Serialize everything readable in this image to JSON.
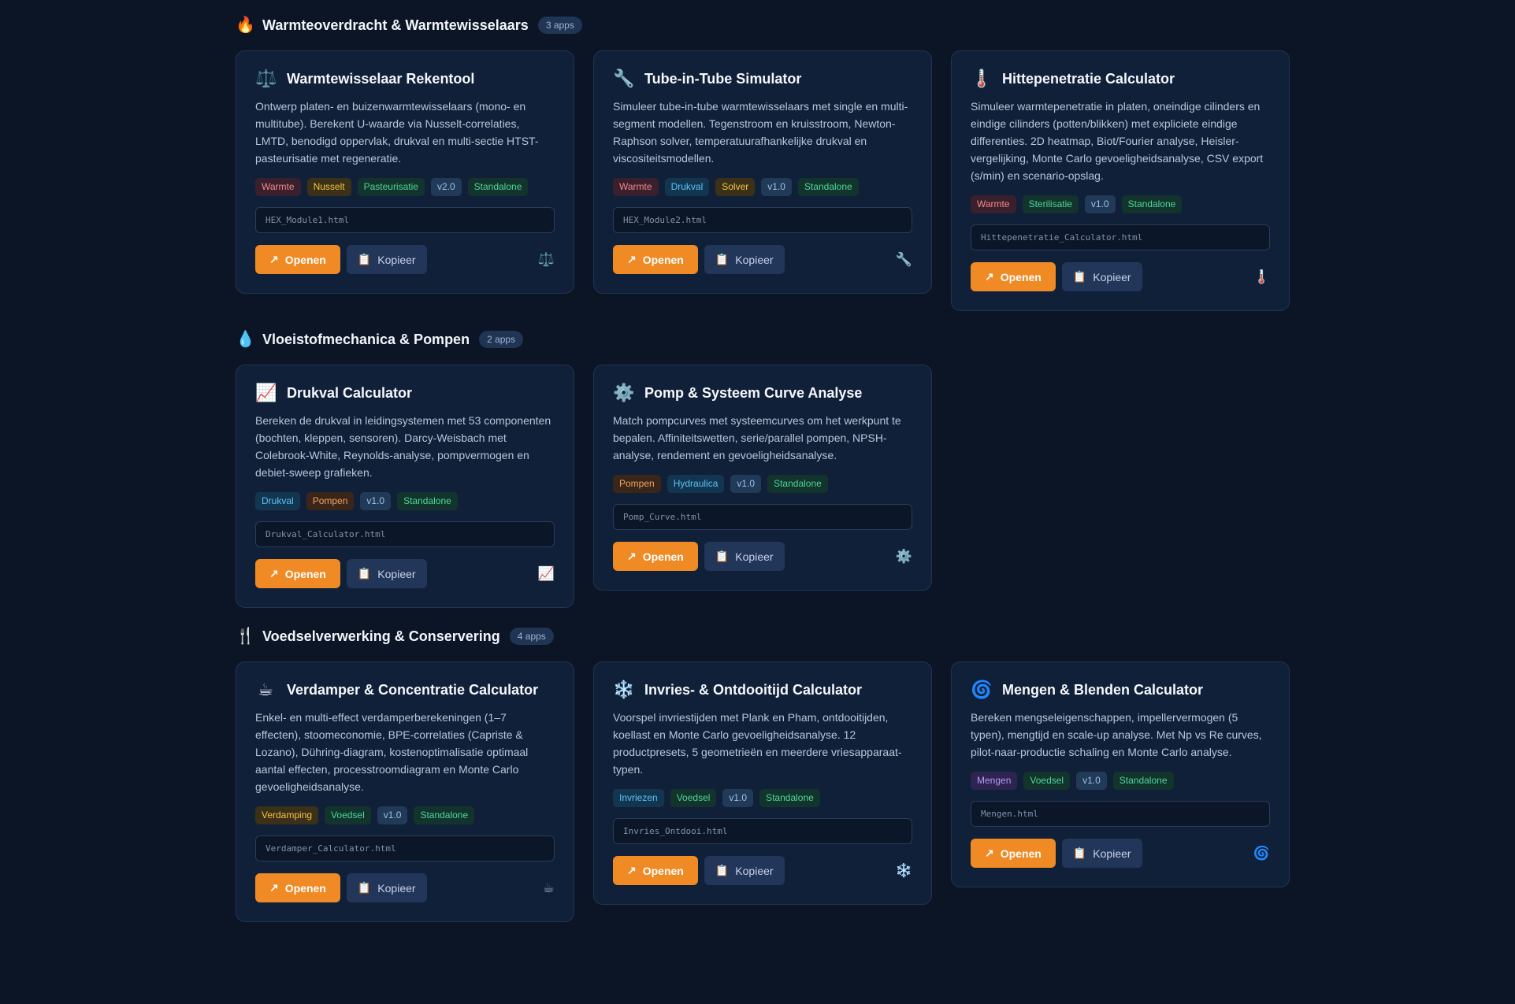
{
  "sections": [
    {
      "icon": "🔥",
      "title": "Warmteoverdracht & Warmtewisselaars",
      "count": "3 apps",
      "cards": [
        {
          "icon": "⚖️",
          "title": "Warmtewisselaar Rekentool",
          "description": "Ontwerp platen- en buizenwarmtewisselaars (mono- en multitube). Berekent U-waarde via Nusselt-correlaties, LMTD, benodigd oppervlak, drukval en multi-sectie HTST-pasteurisatie met regeneratie.",
          "tags": [
            {
              "label": "Warmte",
              "color": "red"
            },
            {
              "label": "Nusselt",
              "color": "yellow"
            },
            {
              "label": "Pasteurisatie",
              "color": "green"
            },
            {
              "label": "v2.0",
              "color": "blue"
            },
            {
              "label": "Standalone",
              "color": "green"
            }
          ],
          "file": "HEX_Module1.html"
        },
        {
          "icon": "🔧",
          "title": "Tube-in-Tube Simulator",
          "description": "Simuleer tube-in-tube warmtewisselaars met single en multi-segment modellen. Tegenstroom en kruisstroom, Newton-Raphson solver, temperatuurafhankelijke drukval en viscositeitsmodellen.",
          "tags": [
            {
              "label": "Warmte",
              "color": "red"
            },
            {
              "label": "Drukval",
              "color": "cyan"
            },
            {
              "label": "Solver",
              "color": "yellow"
            },
            {
              "label": "v1.0",
              "color": "blue"
            },
            {
              "label": "Standalone",
              "color": "green"
            }
          ],
          "file": "HEX_Module2.html"
        },
        {
          "icon": "🌡️",
          "title": "Hittepenetratie Calculator",
          "description": "Simuleer warmtepenetratie in platen, oneindige cilinders en eindige cilinders (potten/blikken) met expliciete eindige differenties. 2D heatmap, Biot/Fourier analyse, Heisler-vergelijking, Monte Carlo gevoeligheidsanalyse, CSV export (s/min) en scenario-opslag.",
          "tags": [
            {
              "label": "Warmte",
              "color": "red"
            },
            {
              "label": "Sterilisatie",
              "color": "green"
            },
            {
              "label": "v1.0",
              "color": "blue"
            },
            {
              "label": "Standalone",
              "color": "green"
            }
          ],
          "file": "Hittepenetratie_Calculator.html"
        }
      ]
    },
    {
      "icon": "💧",
      "title": "Vloeistofmechanica & Pompen",
      "count": "2 apps",
      "cards": [
        {
          "icon": "📈",
          "title": "Drukval Calculator",
          "description": "Bereken de drukval in leidingsystemen met 53 componenten (bochten, kleppen, sensoren). Darcy-Weisbach met Colebrook-White, Reynolds-analyse, pompvermogen en debiet-sweep grafieken.",
          "tags": [
            {
              "label": "Drukval",
              "color": "cyan"
            },
            {
              "label": "Pompen",
              "color": "orange"
            },
            {
              "label": "v1.0",
              "color": "blue"
            },
            {
              "label": "Standalone",
              "color": "green"
            }
          ],
          "file": "Drukval_Calculator.html"
        },
        {
          "icon": "⚙️",
          "title": "Pomp & Systeem Curve Analyse",
          "description": "Match pompcurves met systeemcurves om het werkpunt te bepalen. Affiniteitswetten, serie/parallel pompen, NPSH-analyse, rendement en gevoeligheidsanalyse.",
          "tags": [
            {
              "label": "Pompen",
              "color": "orange"
            },
            {
              "label": "Hydraulica",
              "color": "cyan"
            },
            {
              "label": "v1.0",
              "color": "blue"
            },
            {
              "label": "Standalone",
              "color": "green"
            }
          ],
          "file": "Pomp_Curve.html"
        }
      ]
    },
    {
      "icon": "🍴",
      "title": "Voedselverwerking & Conservering",
      "count": "4 apps",
      "cards": [
        {
          "icon": "☕",
          "title": "Verdamper & Concentratie Calculator",
          "description": "Enkel- en multi-effect verdamperberekeningen (1–7 effecten), stoomeconomie, BPE-correlaties (Capriste & Lozano), Dühring-diagram, kostenoptimalisatie optimaal aantal effecten, processtroomdiagram en Monte Carlo gevoeligheidsanalyse.",
          "tags": [
            {
              "label": "Verdamping",
              "color": "yellow"
            },
            {
              "label": "Voedsel",
              "color": "green"
            },
            {
              "label": "v1.0",
              "color": "blue"
            },
            {
              "label": "Standalone",
              "color": "green"
            }
          ],
          "file": "Verdamper_Calculator.html"
        },
        {
          "icon": "❄️",
          "title": "Invries- & Ontdooitijd Calculator",
          "description": "Voorspel invriestijden met Plank en Pham, ontdooitijden, koellast en Monte Carlo gevoeligheidsanalyse. 12 productpresets, 5 geometrieën en meerdere vriesapparaat-typen.",
          "tags": [
            {
              "label": "Invriezen",
              "color": "cyan"
            },
            {
              "label": "Voedsel",
              "color": "green"
            },
            {
              "label": "v1.0",
              "color": "blue"
            },
            {
              "label": "Standalone",
              "color": "green"
            }
          ],
          "file": "Invries_Ontdooi.html"
        },
        {
          "icon": "🌀",
          "title": "Mengen & Blenden Calculator",
          "description": "Bereken mengseleigenschappen, impellervermogen (5 typen), mengtijd en scale-up analyse. Met Np vs Re curves, pilot-naar-productie schaling en Monte Carlo analyse.",
          "tags": [
            {
              "label": "Mengen",
              "color": "purple"
            },
            {
              "label": "Voedsel",
              "color": "green"
            },
            {
              "label": "v1.0",
              "color": "blue"
            },
            {
              "label": "Standalone",
              "color": "green"
            }
          ],
          "file": "Mengen.html"
        }
      ]
    }
  ],
  "labels": {
    "open": "Openen",
    "copy": "Kopieer",
    "open_icon": "↗",
    "copy_icon": "📋"
  }
}
